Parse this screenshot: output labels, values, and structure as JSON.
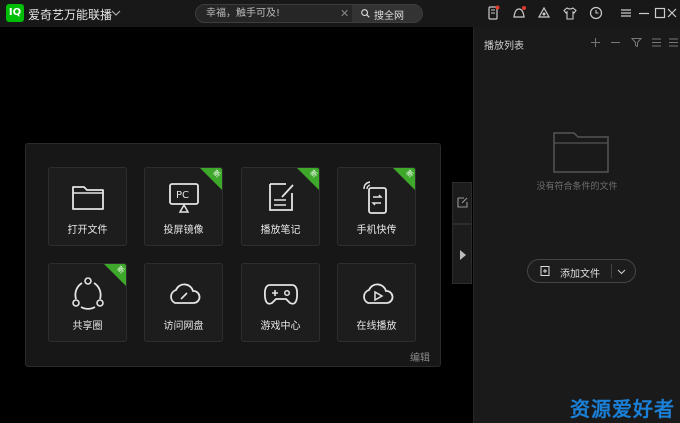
{
  "app": {
    "title": "爱奇艺万能联播",
    "logo_text": "IQ"
  },
  "search": {
    "placeholder": "幸福，触手可及!",
    "button_label": "搜全网"
  },
  "toolbar_icons": [
    "phone-icon",
    "notification-icon",
    "skin-icon",
    "shirt-icon",
    "clock-icon"
  ],
  "window_controls": [
    "menu-icon",
    "minimize-icon",
    "maximize-icon",
    "close-icon"
  ],
  "tiles": [
    {
      "label": "打开文件",
      "icon": "folder-icon",
      "is_new": false
    },
    {
      "label": "投屏镜像",
      "icon": "pc-cast-icon",
      "is_new": true
    },
    {
      "label": "播放笔记",
      "icon": "note-icon",
      "is_new": true
    },
    {
      "label": "手机快传",
      "icon": "phone-transfer-icon",
      "is_new": true
    },
    {
      "label": "共享圈",
      "icon": "share-circle-icon",
      "is_new": true
    },
    {
      "label": "访问网盘",
      "icon": "cloud-icon",
      "is_new": false
    },
    {
      "label": "游戏中心",
      "icon": "gamepad-icon",
      "is_new": false
    },
    {
      "label": "在线播放",
      "icon": "cloud-play-icon",
      "is_new": false
    }
  ],
  "badge_text": "新",
  "panel_edit_label": "编辑",
  "playlist": {
    "title": "播放列表",
    "empty_text": "没有符合条件的文件",
    "add_button_label": "添加文件"
  },
  "watermark": "资源爱好者",
  "colors": {
    "brand_green": "#00be06",
    "badge_green": "#3ea82b",
    "watermark_blue": "#1a7fd6"
  }
}
